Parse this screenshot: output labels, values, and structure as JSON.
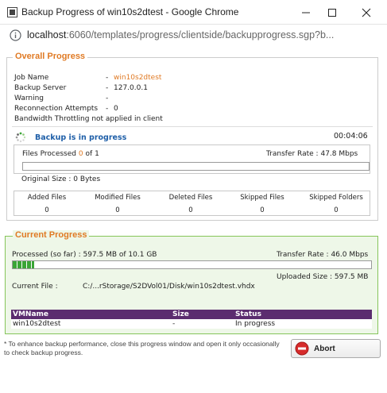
{
  "window": {
    "title": "Backup Progress of win10s2dtest - Google Chrome",
    "url_host": "localhost",
    "url_rest": ":6060/templates/progress/clientside/backupprogress.sgp?b..."
  },
  "overall": {
    "title": "Overall Progress",
    "job_name_label": "Job Name",
    "job_name_value": "win10s2dtest",
    "backup_server_label": "Backup Server",
    "backup_server_value": "127.0.0.1",
    "warning_label": "Warning",
    "warning_value": "",
    "reconnect_label": "Reconnection Attempts",
    "reconnect_value": "0",
    "throttling_text": "Bandwidth Throttling not applied in client",
    "status_text": "Backup is in progress",
    "elapsed": "00:04:06",
    "files_processed_label": "Files Processed",
    "files_processed_done": "0",
    "files_processed_of": "of",
    "files_processed_total": "1",
    "transfer_rate_label": "Transfer Rate :",
    "transfer_rate_value": "47.8 Mbps",
    "progress_fraction": 0,
    "original_size_text": "Original Size : 0 Bytes",
    "stats": [
      {
        "label": "Added Files",
        "value": "0"
      },
      {
        "label": "Modified Files",
        "value": "0"
      },
      {
        "label": "Deleted Files",
        "value": "0"
      },
      {
        "label": "Skipped Files",
        "value": "0"
      },
      {
        "label": "Skipped Folders",
        "value": "0"
      }
    ]
  },
  "current": {
    "title": "Current Progress",
    "processed_text": "Processed (so far) : 597.5 MB  of  10.1 GB",
    "transfer_rate_text": "Transfer Rate : 46.0 Mbps",
    "progress_fraction": 0.06,
    "uploaded_text": "Uploaded Size : 597.5 MB",
    "current_file_label": "Current File :",
    "current_file_value": "C:/...rStorage/S2DVol01/Disk/win10s2dtest.vhdx",
    "table": {
      "columns": [
        "VMName",
        "Size",
        "Status"
      ],
      "rows": [
        [
          "win10s2dtest",
          "-",
          "In progress"
        ]
      ]
    }
  },
  "footer": {
    "note": "* To enhance backup performance, close this progress window and open it only occasionally to check backup progress.",
    "abort_label": "Abort"
  },
  "colors": {
    "accent_orange": "#e07a24",
    "status_blue": "#1f5fa8",
    "table_header": "#5b2c6f",
    "progress_green": "#3aa536",
    "current_panel_bg": "#eef7e8"
  }
}
